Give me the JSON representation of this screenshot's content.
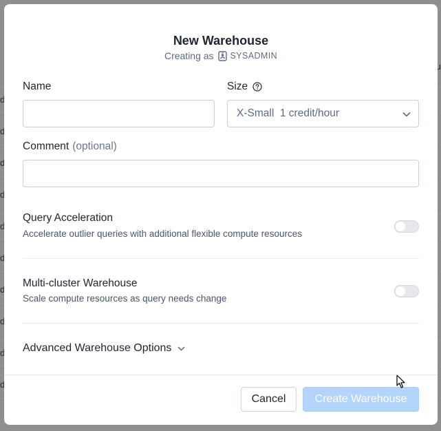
{
  "background": {
    "row_letters": [
      "d",
      "d",
      "d",
      "d",
      "d",
      "d",
      "d",
      "d",
      "d",
      "d"
    ],
    "right_letter": "u"
  },
  "modal": {
    "title": "New Warehouse",
    "subtitle_prefix": "Creating as",
    "role_icon": "user-badge-icon",
    "role": "SYSADMIN"
  },
  "form": {
    "name": {
      "label": "Name",
      "value": "",
      "placeholder": ""
    },
    "size": {
      "label": "Size",
      "help_icon": "help-circle-icon",
      "selected": "X-Small  1 credit/hour"
    },
    "comment": {
      "label": "Comment",
      "optional": "(optional)",
      "value": "",
      "placeholder": ""
    }
  },
  "options": [
    {
      "title": "Query Acceleration",
      "description": "Accelerate outlier queries with additional flexible compute resources",
      "enabled": false
    },
    {
      "title": "Multi-cluster Warehouse",
      "description": "Scale compute resources as query needs change",
      "enabled": false
    }
  ],
  "advanced": {
    "label": "Advanced Warehouse Options",
    "icon": "chevron-down-icon"
  },
  "footer": {
    "cancel_label": "Cancel",
    "create_label": "Create Warehouse"
  },
  "colors": {
    "primary_disabled": "#b3d4fb",
    "text": "#1e252f",
    "muted": "#5d6a85"
  }
}
